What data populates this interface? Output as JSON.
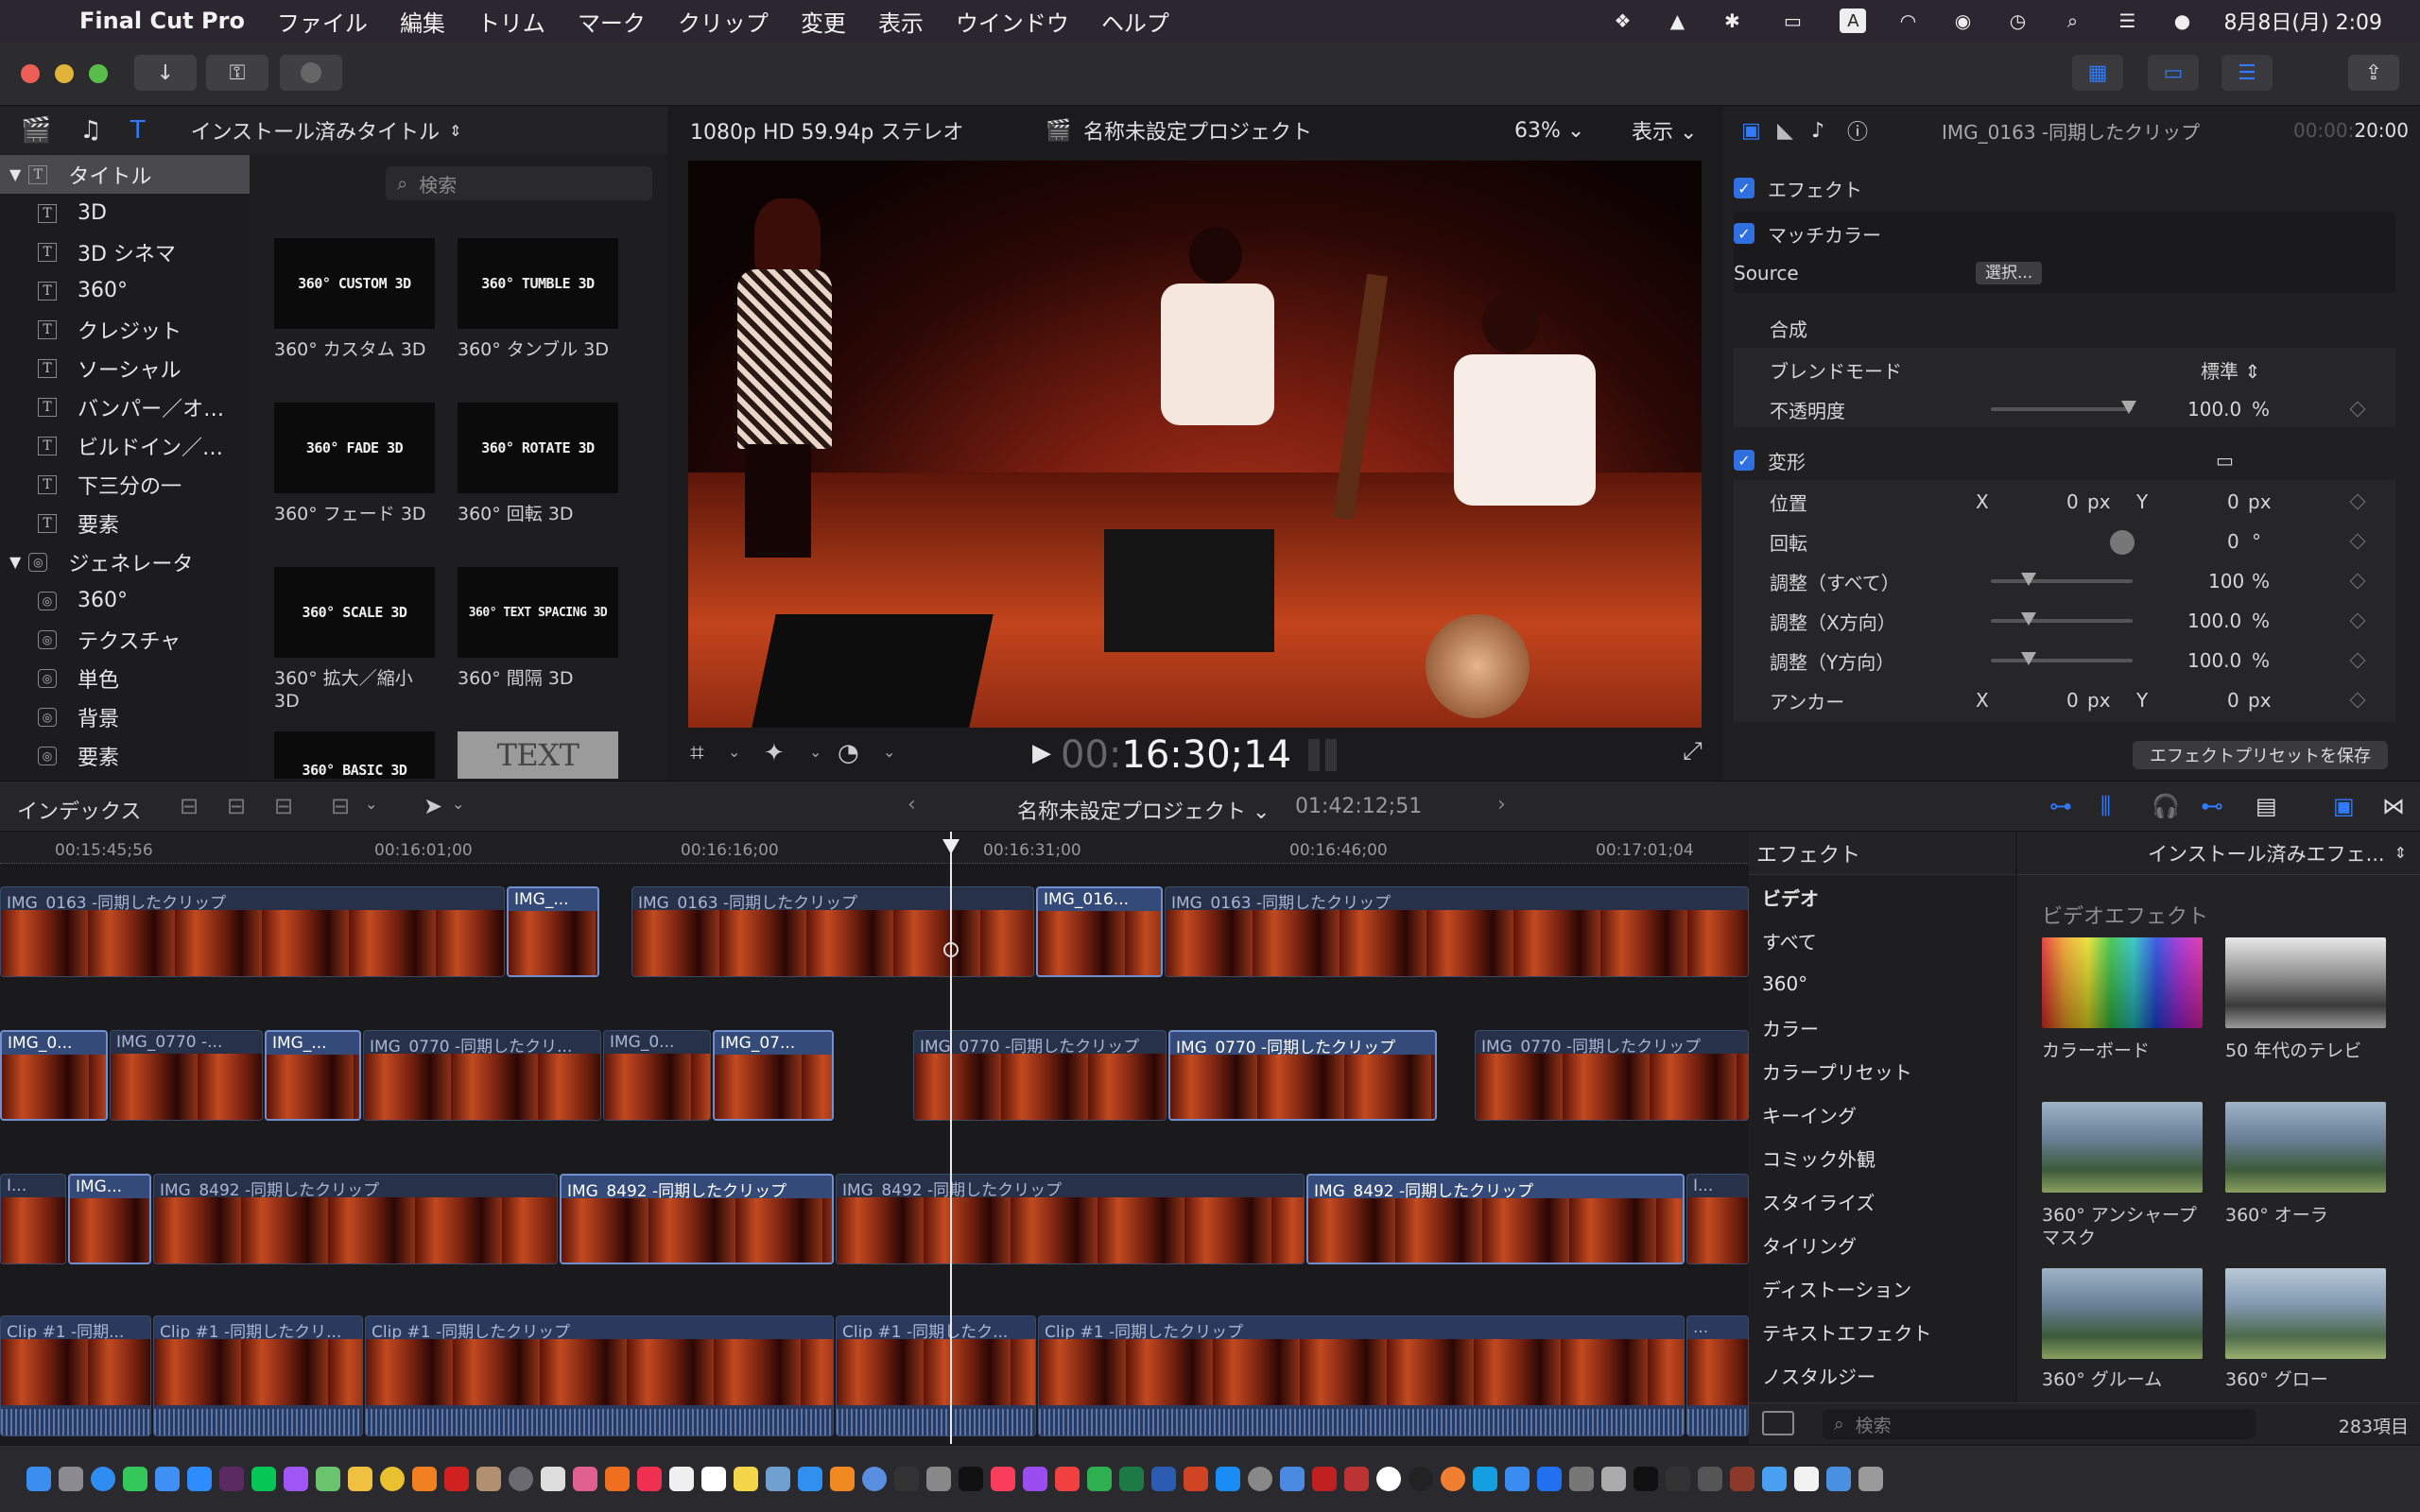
{
  "menubar": {
    "app_name": "Final Cut Pro",
    "items": [
      "ファイル",
      "編集",
      "トリム",
      "マーク",
      "クリップ",
      "変更",
      "表示",
      "ウインドウ",
      "ヘルプ"
    ],
    "clock": "8月8日(月)  2:09"
  },
  "browser": {
    "dropdown_label": "インストール済みタイトル",
    "search_placeholder": "検索",
    "sidebar": [
      {
        "label": "タイトル",
        "kind": "group",
        "selected": true
      },
      {
        "label": "3D",
        "kind": "title"
      },
      {
        "label": "3D シネマ",
        "kind": "title"
      },
      {
        "label": "360°",
        "kind": "title"
      },
      {
        "label": "クレジット",
        "kind": "title"
      },
      {
        "label": "ソーシャル",
        "kind": "title"
      },
      {
        "label": "バンパー／オ…",
        "kind": "title"
      },
      {
        "label": "ビルドイン／…",
        "kind": "title"
      },
      {
        "label": "下三分の一",
        "kind": "title"
      },
      {
        "label": "要素",
        "kind": "title"
      },
      {
        "label": "ジェネレータ",
        "kind": "group2"
      },
      {
        "label": "360°",
        "kind": "gen"
      },
      {
        "label": "テクスチャ",
        "kind": "gen"
      },
      {
        "label": "単色",
        "kind": "gen"
      },
      {
        "label": "背景",
        "kind": "gen"
      },
      {
        "label": "要素",
        "kind": "gen"
      }
    ],
    "tiles": [
      {
        "thumb": "360° CUSTOM 3D",
        "label": "360° カスタム 3D"
      },
      {
        "thumb": "360° TUMBLE 3D",
        "label": "360° タンブル 3D"
      },
      {
        "thumb": "360° FADE 3D",
        "label": "360° フェード 3D"
      },
      {
        "thumb": "360° ROTATE 3D",
        "label": "360° 回転 3D"
      },
      {
        "thumb": "360° SCALE 3D",
        "label": "360° 拡大／縮小 3D"
      },
      {
        "thumb": "360° TEXT SPACING 3D",
        "label": "360° 間隔 3D"
      },
      {
        "thumb": "360° BASIC 3D",
        "label": ""
      },
      {
        "thumb": "TEXT",
        "label": ""
      }
    ]
  },
  "viewer": {
    "format": "1080p HD 59.94p ステレオ",
    "project": "名称未設定プロジェクト",
    "zoom": "63%",
    "view_menu": "表示",
    "timecode_dim": "00:",
    "timecode": "16:30;14"
  },
  "inspector": {
    "clip_name": "IMG_0163 -同期したクリップ",
    "duration_dim": "00:00:",
    "duration": "20:00",
    "effects_label": "エフェクト",
    "match_color_label": "マッチカラー",
    "source_label": "Source",
    "choose_button": "選択...",
    "compositing_label": "合成",
    "blend_mode_label": "ブレンドモード",
    "blend_mode_value": "標準",
    "opacity_label": "不透明度",
    "opacity_value": "100.0",
    "percent": "%",
    "transform_label": "変形",
    "position_label": "位置",
    "x": "X",
    "y": "Y",
    "px": "px",
    "position_x": "0",
    "position_y": "0",
    "rotation_label": "回転",
    "rotation_value": "0",
    "degree": "°",
    "scale_all_label": "調整（すべて）",
    "scale_all_value": "100",
    "scale_x_label": "調整（X方向）",
    "scale_x_value": "100.0",
    "scale_y_label": "調整（Y方向）",
    "scale_y_value": "100.0",
    "anchor_label": "アンカー",
    "anchor_x": "0",
    "anchor_y": "0",
    "save_preset_button": "エフェクトプリセットを保存"
  },
  "timeline_bar": {
    "index_label": "インデックス",
    "project": "名称未設定プロジェクト",
    "duration": "01:42:12;51"
  },
  "ruler": [
    "00:15:45;56",
    "00:16:01;00",
    "00:16:16;00",
    "00:16:31;00",
    "00:16:46;00",
    "00:17:01;04"
  ],
  "tracks": {
    "row1": [
      "IMG_0163 -同期したクリップ",
      "IMG_...",
      "IMG_0163 -同期したクリップ",
      "IMG_016...",
      "IMG_0163 -同期したクリップ"
    ],
    "row2": [
      "IMG_0...",
      "IMG_0770 -...",
      "IMG_...",
      "IMG_0770 -同期したクリ...",
      "IMG_0...",
      "IMG_07...",
      "IMG_0770 -同期したクリップ",
      "IMG_0770 -同期したクリップ",
      "IMG_0770 -同期したクリップ"
    ],
    "row3": [
      "I...",
      "IMG...",
      "IMG_8492 -同期したクリップ",
      "IMG_8492 -同期したクリップ",
      "IMG_8492 -同期したクリップ",
      "IMG_8492 -同期したクリップ",
      "I..."
    ],
    "row4": [
      "Clip #1 -同期...",
      "Clip #1 -同期したクリ...",
      "Clip #1 -同期したクリップ",
      "Clip #1 -同期したク...",
      "Clip #1 -同期したクリップ",
      "..."
    ]
  },
  "effects": {
    "header": "エフェクト",
    "source_dropdown": "インストール済みエフェ...",
    "categories": [
      "ビデオ",
      "すべて",
      "360°",
      "カラー",
      "カラープリセット",
      "キーイング",
      "コミック外観",
      "スタイライズ",
      "タイリング",
      "ディストーション",
      "テキストエフェクト",
      "ノスタルジー"
    ],
    "section": "ビデオエフェクト",
    "items": [
      {
        "label": "カラーボード"
      },
      {
        "label": "50 年代のテレビ"
      },
      {
        "label": "360° アンシャープマスク"
      },
      {
        "label": "360° オーラ"
      },
      {
        "label": "360° グルーム"
      },
      {
        "label": "360° グロー"
      }
    ],
    "search_placeholder": "検索",
    "count": "283項目"
  }
}
